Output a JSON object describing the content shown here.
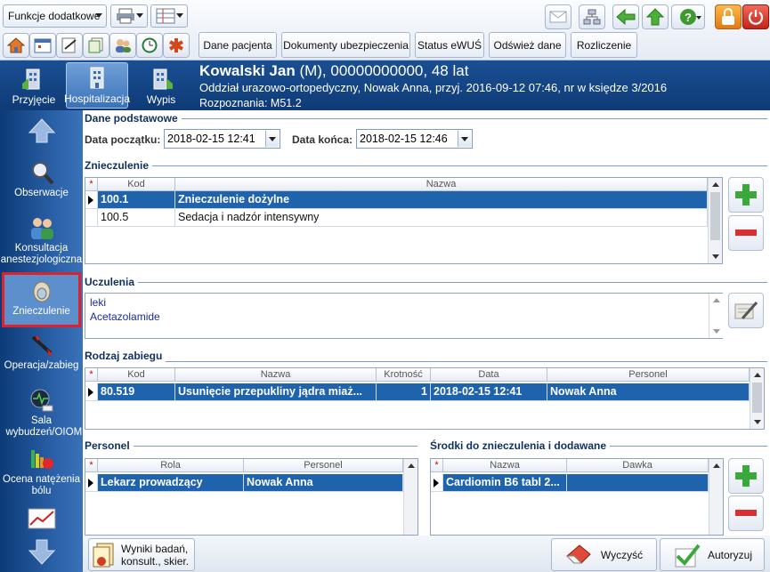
{
  "toolbar": {
    "functions_label": "Funkcje dodatkowe",
    "buttons": [
      "Dane pacjenta",
      "Dokumenty ubezpieczenia",
      "Status eWUŚ",
      "Odśwież dane",
      "Rozliczenie"
    ]
  },
  "nav_top": [
    {
      "label": "Przyjęcie",
      "icon": "building-admission-icon"
    },
    {
      "label": "Hospitalizacja",
      "icon": "building-hospital-icon"
    },
    {
      "label": "Wypis",
      "icon": "building-discharge-icon"
    }
  ],
  "patient": {
    "name": "Kowalski Jan",
    "details": "(M), 00000000000, 48 lat",
    "info": "Oddział urazowo-ortopedyczny, Nowak Anna, przyj. 2016-09-12 07:46, nr w księdze 3/2016",
    "diagnosis": "Rozpoznania: M51.2"
  },
  "sidebar": [
    {
      "label": "Obserwacje"
    },
    {
      "label": "Konsultacja anestezjologiczna"
    },
    {
      "label": "Znieczulenie"
    },
    {
      "label": "Operacja/zabieg"
    },
    {
      "label": "Sala wybudzeń/OIOM"
    },
    {
      "label": "Ocena natężenia bólu"
    }
  ],
  "basic": {
    "section": "Dane podstawowe",
    "start_label": "Data początku:",
    "start_value": "2018-02-15 12:41",
    "end_label": "Data końca:",
    "end_value": "2018-02-15 12:46"
  },
  "anesthesia": {
    "section": "Znieczulenie",
    "columns": [
      "*",
      "Kod",
      "Nazwa"
    ],
    "rows": [
      {
        "code": "100.1",
        "name": "Znieczulenie dożylne"
      },
      {
        "code": "100.5",
        "name": "Sedacja i nadzór intensywny"
      }
    ]
  },
  "allergies": {
    "section": "Uczulenia",
    "lines": [
      "leki",
      "Acetazolamide"
    ]
  },
  "procedure": {
    "section": "Rodzaj zabiegu",
    "columns": [
      "*",
      "Kod",
      "Nazwa",
      "Krotność",
      "Data",
      "Personel"
    ],
    "rows": [
      {
        "code": "80.519",
        "name": "Usunięcie przepukliny jądra miaż...",
        "mult": "1",
        "date": "2018-02-15 12:41",
        "staff": "Nowak Anna"
      }
    ]
  },
  "staff": {
    "section": "Personel",
    "columns": [
      "*",
      "Rola",
      "Personel"
    ],
    "rows": [
      {
        "role": "Lekarz prowadzący",
        "person": "Nowak Anna"
      }
    ]
  },
  "drugs": {
    "section": "Środki do znieczulenia i dodawane",
    "columns": [
      "*",
      "Nazwa",
      "Dawka"
    ],
    "rows": [
      {
        "name": "Cardiomin B6 tabl 2...",
        "dose": ""
      }
    ]
  },
  "footer": {
    "results": "Wyniki badań, konsult., skier.",
    "clear": "Wyczyść",
    "authorize": "Autoryzuj"
  }
}
